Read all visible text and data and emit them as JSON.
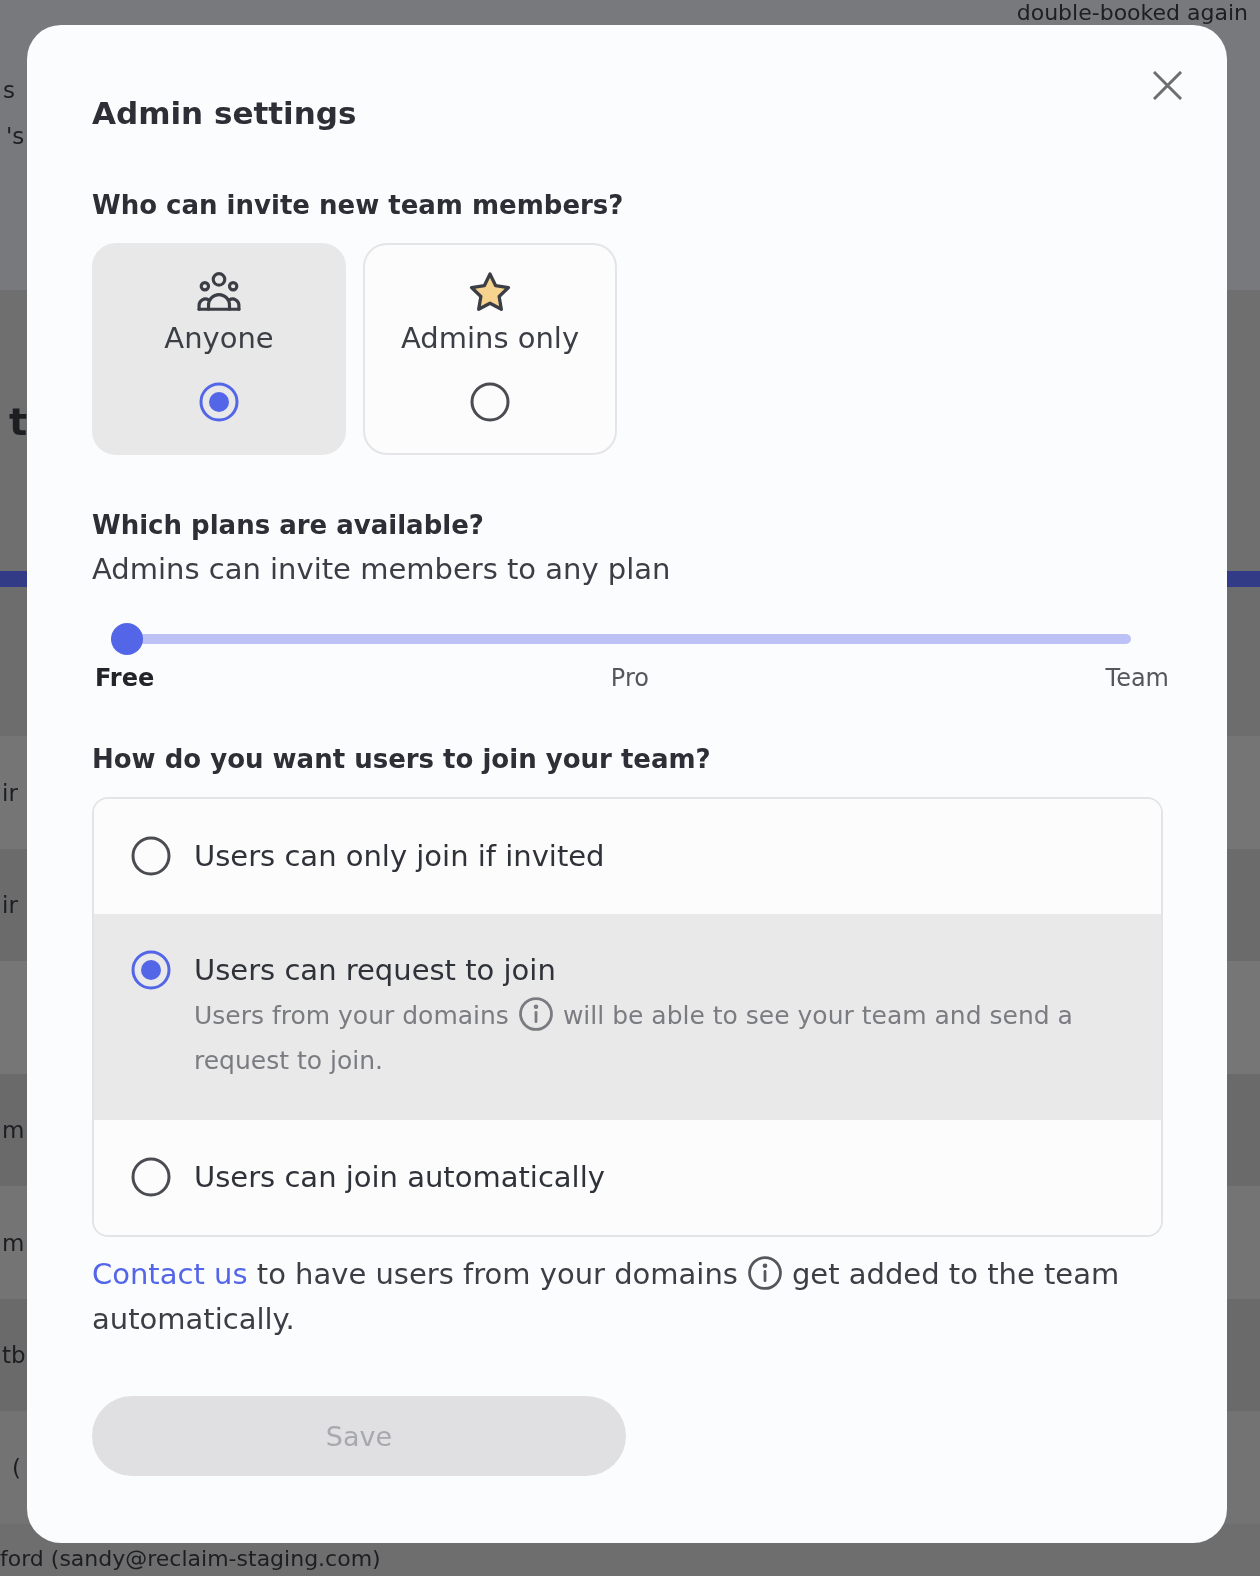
{
  "backdrop": {
    "top_text": "double-booked again",
    "side_fragments": [
      "s",
      "'s",
      "t",
      "ir",
      "ir",
      "m",
      "m",
      "tb",
      "("
    ],
    "bottom_text": "ford (sandy@reclaim-staging.com)"
  },
  "dialog": {
    "title": "Admin settings"
  },
  "invite": {
    "heading": "Who can invite new team members?",
    "options": [
      {
        "kind": "group",
        "label": "Anyone",
        "selected": true
      },
      {
        "kind": "star",
        "label": "Admins only",
        "selected": false
      }
    ]
  },
  "plans": {
    "heading": "Which plans are available?",
    "subheading": "Admins can invite members to any plan",
    "slider": {
      "level": 0,
      "stops": [
        {
          "label": "Free",
          "selected": true
        },
        {
          "label": "Pro",
          "selected": false
        },
        {
          "label": "Team",
          "selected": false
        }
      ]
    }
  },
  "join": {
    "heading": "How do you want users to join your team?",
    "options": [
      {
        "label": "Users can only join if invited",
        "selected": false
      },
      {
        "label": "Users can request to join",
        "selected": true,
        "description": [
          {
            "kind": "text",
            "text": "Users from your domains"
          },
          {
            "kind": "info"
          },
          {
            "kind": "text",
            "text": "will be able to see your team and send a request to join."
          }
        ]
      },
      {
        "label": "Users can join automatically",
        "selected": false
      }
    ]
  },
  "note": [
    {
      "kind": "link",
      "text": "Contact us"
    },
    {
      "kind": "text",
      "text": "to have users from your domains"
    },
    {
      "kind": "info"
    },
    {
      "kind": "text",
      "text": "get added to the team automatically."
    }
  ],
  "save_button": {
    "label": "Save",
    "disabled": true
  }
}
